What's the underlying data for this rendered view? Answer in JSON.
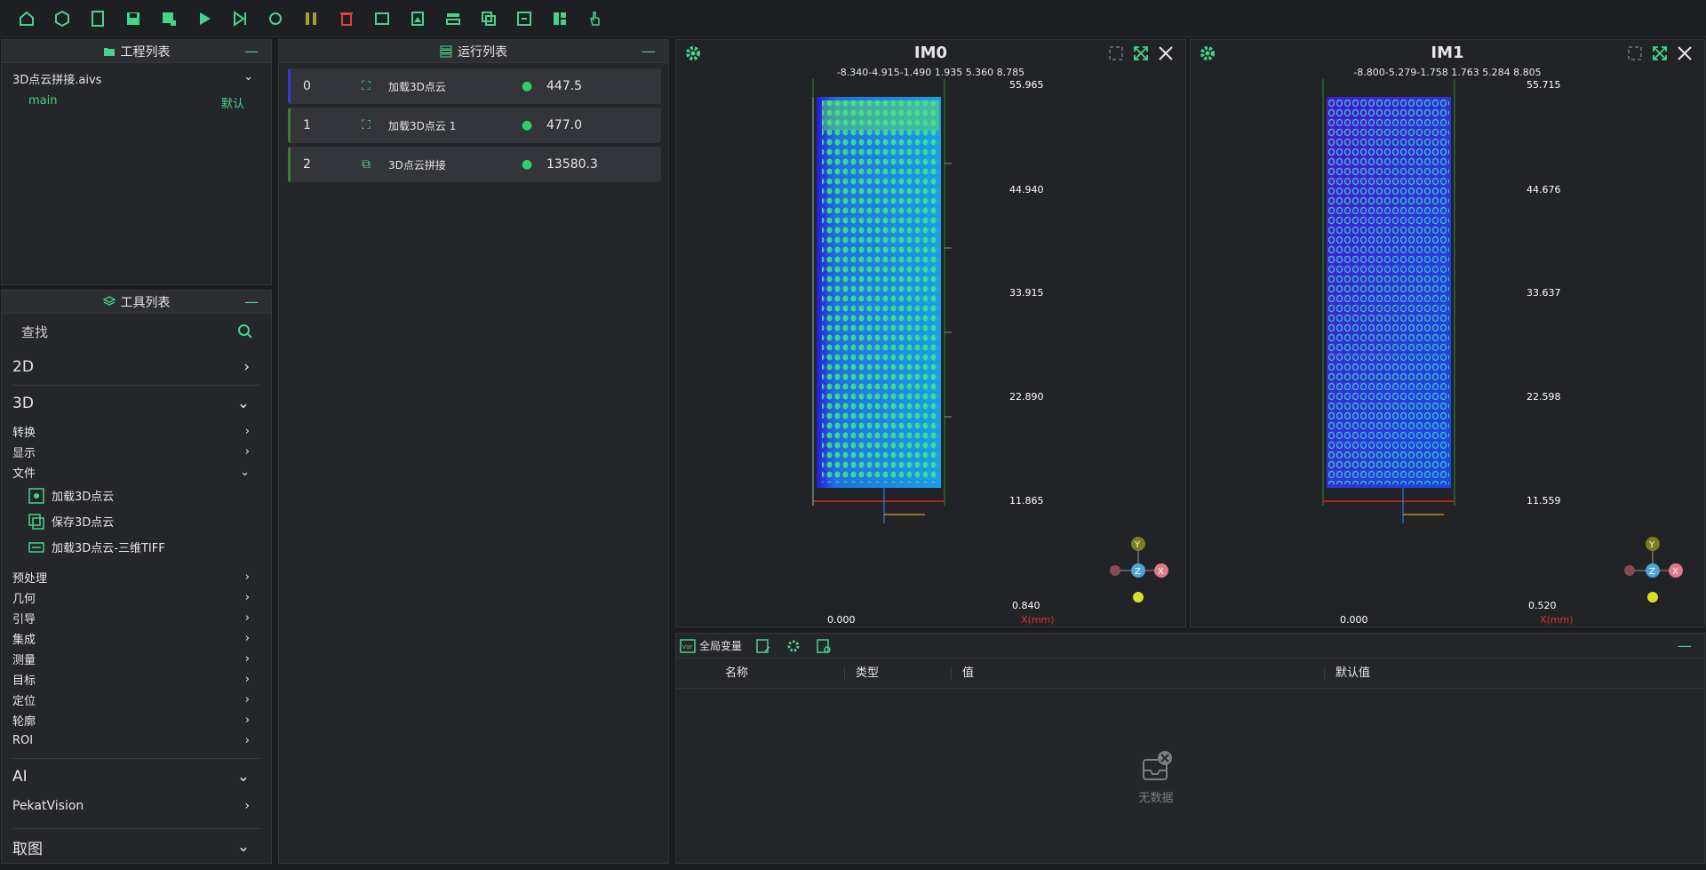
{
  "toolbar": {
    "icons": [
      "home-run-icon",
      "cube-icon",
      "document-icon",
      "save-icon",
      "save-as-icon",
      "play-icon",
      "step-icon",
      "loop-icon",
      "pause-icon",
      "delete-icon",
      "image-icon",
      "image-frame-icon",
      "layers-icon",
      "copy-icon",
      "export-icon",
      "layout-icon",
      "hand-icon"
    ]
  },
  "project": {
    "title": "工程列表",
    "file": "3D点云拼接.aivs",
    "main": "main",
    "default": "默认"
  },
  "tools": {
    "title": "工具列表",
    "search": "查找",
    "cats": {
      "c2d": "2D",
      "c3d": "3D",
      "ai": "AI",
      "pekat": "PekatVision",
      "qutu": "取图"
    },
    "sub3d": {
      "convert": "转换",
      "display": "显示",
      "file": "文件",
      "preprocess": "预处理",
      "geometry": "几何",
      "guide": "引导",
      "integrate": "集成",
      "measure": "测量",
      "target": "目标",
      "locate": "定位",
      "contour": "轮廓",
      "roi": "ROI"
    },
    "leaves": {
      "l1": "加载3D点云",
      "l2": "保存3D点云",
      "l3": "加载3D点云-三维TIFF"
    }
  },
  "run": {
    "title": "运行列表",
    "rows": [
      {
        "idx": "0",
        "name": "加载3D点云",
        "time": "447.5"
      },
      {
        "idx": "1",
        "name": "加载3D点云 1",
        "time": "477.0"
      },
      {
        "idx": "2",
        "name": "3D点云拼接",
        "time": "13580.3"
      }
    ]
  },
  "views": [
    {
      "title": "IM0",
      "xticks": "-8.340-4.915-1.490 1.935  5.360  8.785",
      "y": {
        "y1": "55.965",
        "y2": "44.940",
        "y3": "33.915",
        "y4": "22.890",
        "y5": "11.865",
        "y6": "0.840"
      },
      "origin": "0.000",
      "xunit": "X(mm)"
    },
    {
      "title": "IM1",
      "xticks": "-8.800-5.279-1.758 1.763  5.284  8.805",
      "y": {
        "y1": "55.715",
        "y2": "44.676",
        "y3": "33.637",
        "y4": "22.598",
        "y5": "11.559",
        "y6": "0.520"
      },
      "origin": "0.000",
      "xunit": "X(mm)"
    }
  ],
  "axes": {
    "y": "Y",
    "z": "Z",
    "x": "X"
  },
  "vars": {
    "title": "全局变量",
    "cols": {
      "name": "名称",
      "type": "类型",
      "value": "值",
      "default": "默认值"
    },
    "empty": "无数据"
  },
  "colors": {
    "accent": "#46d48c",
    "ok": "#2cd16a",
    "delete": "#e04040",
    "pause": "#a89a3a"
  }
}
